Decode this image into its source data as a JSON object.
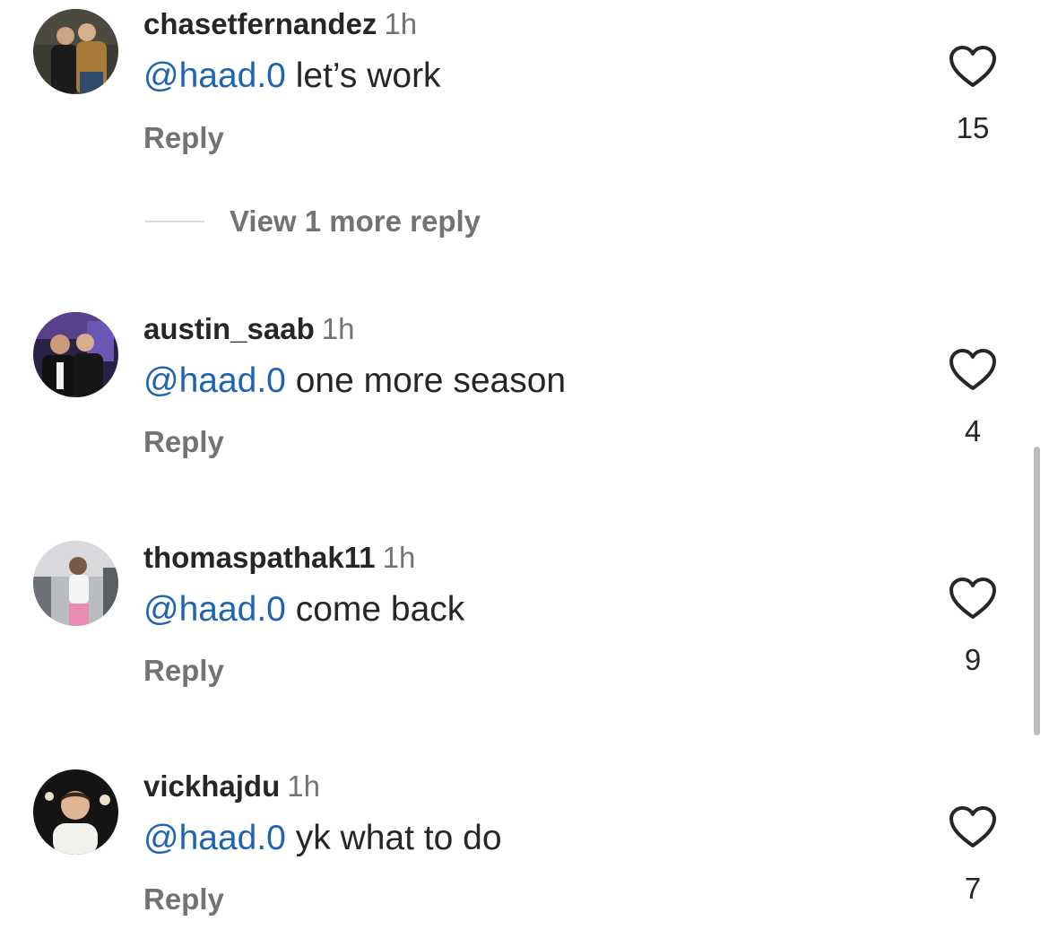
{
  "colors": {
    "username": "#262626",
    "secondary": "#737373",
    "mention": "#1f64b0",
    "divider": "#dbdbdb"
  },
  "comments": [
    {
      "username": "chasetfernandez",
      "time": "1h",
      "mention": "@haad.0",
      "text": " let’s work",
      "reply_label": "Reply",
      "like_icon": "heart-outline-icon",
      "likes": "15"
    },
    {
      "username": "austin_saab",
      "time": "1h",
      "mention": "@haad.0",
      "text": " one more season",
      "reply_label": "Reply",
      "like_icon": "heart-outline-icon",
      "likes": "4"
    },
    {
      "username": "thomaspathak11",
      "time": "1h",
      "mention": "@haad.0",
      "text": " come back",
      "reply_label": "Reply",
      "like_icon": "heart-outline-icon",
      "likes": "9"
    },
    {
      "username": "vickhajdu",
      "time": "1h",
      "mention": "@haad.0",
      "text": " yk what to do",
      "reply_label": "Reply",
      "like_icon": "heart-outline-icon",
      "likes": "7"
    }
  ],
  "view_more_replies": "View 1 more reply"
}
